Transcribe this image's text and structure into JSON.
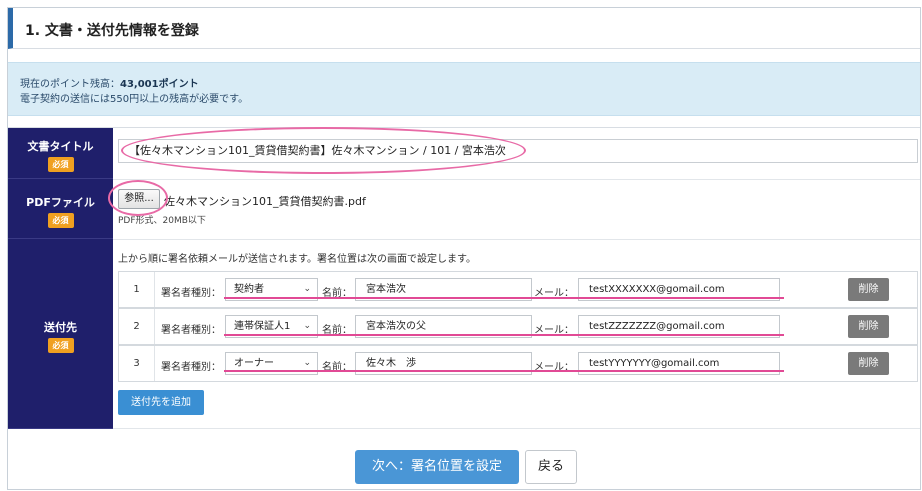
{
  "section": {
    "title": "1. 文書・送付先情報を登録"
  },
  "info": {
    "points_label": "現在のポイント残高：",
    "points_value": "43,001ポイント",
    "notice": "電子契約の送信には550円以上の残高が必要です。"
  },
  "labels": {
    "doc_title": "文書タイトル",
    "pdf_file": "PDFファイル",
    "recipients": "送付先",
    "required": "必須"
  },
  "doc_title_value": "【佐々木マンション101_賃貸借契約書】佐々木マンション / 101 / 宮本浩次",
  "pdf": {
    "browse_label": "参照...",
    "file_name": "佐々木マンション101_賃貸借契約書.pdf",
    "note": "PDF形式、20MB以下"
  },
  "signer_note": "上から順に署名依頼メールが送信されます。署名位置は次の画面で設定します。",
  "signer_labels": {
    "type": "署名者種別：",
    "name": "名前：",
    "mail": "メール：",
    "delete": "削除"
  },
  "signers": [
    {
      "num": "1",
      "type": "契約者",
      "name": "宮本浩次",
      "email": "testXXXXXXX@gomail.com"
    },
    {
      "num": "2",
      "type": "連帯保証人1",
      "name": "宮本浩次の父",
      "email": "testZZZZZZZ@gomail.com"
    },
    {
      "num": "3",
      "type": "オーナー",
      "name": "佐々木　渉",
      "email": "testYYYYYYY@gomail.com"
    }
  ],
  "add_recipient_label": "送付先を追加",
  "next_label": "次へ：署名位置を設定",
  "back_label": "戻る",
  "colors": {
    "header_accent": "#2c6aa8",
    "label_bg": "#1f1f6b",
    "required_badge": "#f0a020",
    "info_bg": "#d9ecf6",
    "primary_button": "#4a96d6",
    "delete_button": "#7a7a7a",
    "annotation": "#e86aa6"
  }
}
